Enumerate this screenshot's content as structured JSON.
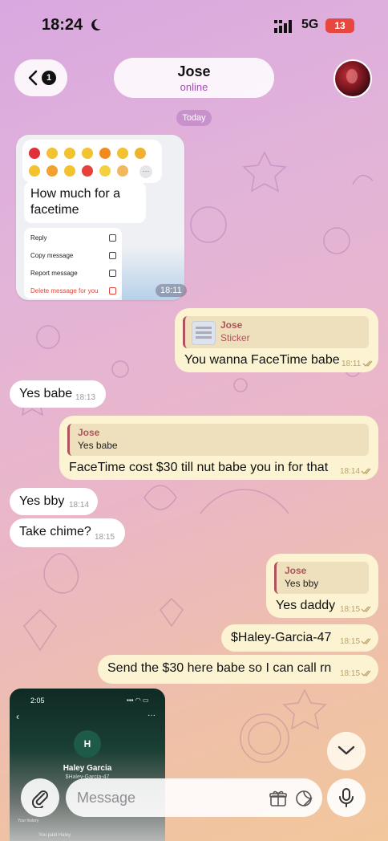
{
  "status_bar": {
    "time": "18:24",
    "network": "5G",
    "battery": "13"
  },
  "header": {
    "back_badge": "1",
    "contact_name": "Jose",
    "contact_status": "online"
  },
  "date_separator": "Today",
  "image_message": {
    "quoted_text": "How much for a facetime",
    "menu": [
      "Reply",
      "Copy message",
      "Report message",
      "Delete message for you"
    ],
    "time": "18:11"
  },
  "messages": {
    "m1": {
      "reply_name": "Jose",
      "reply_text": "Sticker",
      "text": "You wanna FaceTime babe",
      "time": "18:11"
    },
    "m2": {
      "text": "Yes babe",
      "time": "18:13"
    },
    "m3": {
      "reply_name": "Jose",
      "reply_text": "Yes babe",
      "text": "FaceTime cost $30 till nut babe you in for that",
      "time": "18:14"
    },
    "m4": {
      "text": "Yes bby",
      "time": "18:14"
    },
    "m5": {
      "text": "Take chime?",
      "time": "18:15"
    },
    "m6": {
      "reply_name": "Jose",
      "reply_text": "Yes bby",
      "text": "Yes daddy",
      "time": "18:15"
    },
    "m7": {
      "text": "$Haley-Garcia-47",
      "time": "18:15"
    },
    "m8": {
      "text": "Send the $30 here babe so I can call rn",
      "time": "18:15"
    }
  },
  "preview": {
    "time": "2:05",
    "avatar_initial": "H",
    "name": "Haley Garcia",
    "handle": "$Haley-Garcia-47",
    "history_label": "Your history",
    "paid_label": "You paid Haley"
  },
  "composer": {
    "placeholder": "Message"
  },
  "colors": {
    "outgoing_bubble": "#fbf3d1",
    "incoming_bubble": "#ffffff",
    "accent": "#b0525c"
  }
}
